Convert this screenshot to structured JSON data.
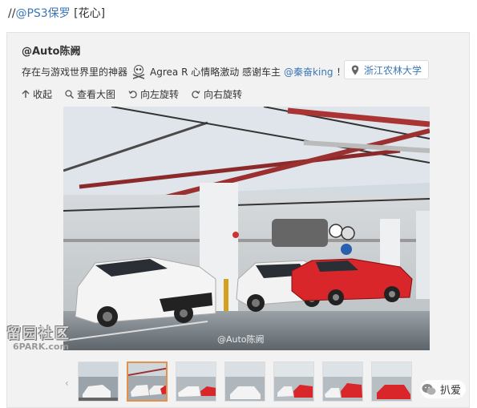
{
  "repost": {
    "prefix": "//",
    "mention": "@PS3保罗",
    "emoji": " [花心]"
  },
  "post": {
    "author": "@Auto陈阙",
    "text_before": "存在与游戏世界里的神器",
    "text_after": "Agrea R 心情略激动 感谢车主",
    "mention": "@秦奋king",
    "suffix": "！",
    "location": "浙江农林大学"
  },
  "toolbar": {
    "collapse": "收起",
    "view_large": "查看大图",
    "rotate_left": "向左旋转",
    "rotate_right": "向右旋转"
  },
  "image": {
    "watermark": "@Auto陈阙"
  },
  "site": {
    "logo": "留园社区",
    "url": "6PARK.com"
  },
  "wechat": {
    "name": "扒爱"
  },
  "colors": {
    "link": "#3c76b6",
    "active_thumb": "#e6914a",
    "card_bg": "#f2f2f2"
  }
}
